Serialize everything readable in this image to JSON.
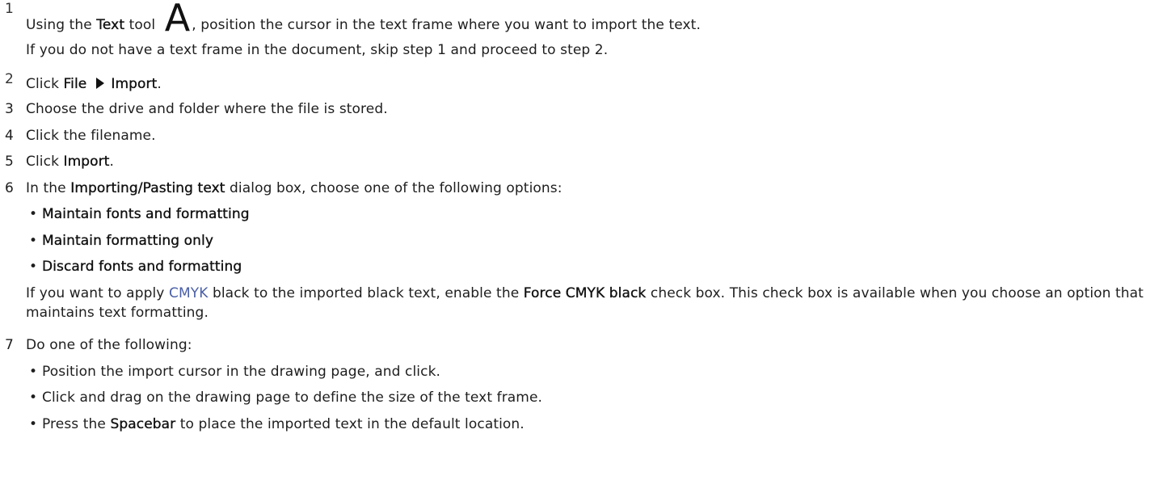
{
  "steps": [
    {
      "number": "1",
      "parts": {
        "a": "Using the ",
        "tool": "Text",
        "b": " tool ",
        "icon": "A",
        "c": ", position the cursor in the text frame where you want to import the text."
      },
      "note": "If you do not have a text frame in the document, skip step 1 and proceed to step 2."
    },
    {
      "number": "2",
      "parts": {
        "a": "Click ",
        "menu1": "File",
        "menu2": "Import",
        "end": "."
      }
    },
    {
      "number": "3",
      "text": "Choose the drive and folder where the file is stored."
    },
    {
      "number": "4",
      "text": "Click the filename."
    },
    {
      "number": "5",
      "parts": {
        "a": "Click ",
        "ui": "Import",
        "end": "."
      }
    },
    {
      "number": "6",
      "parts": {
        "a": "In the ",
        "ui": "Importing/Pasting text",
        "b": " dialog box, choose one of the following options:"
      },
      "options": [
        "Maintain fonts and formatting",
        "Maintain formatting only",
        "Discard fonts and formatting"
      ],
      "note": {
        "a": "If you want to apply ",
        "link": "CMYK",
        "b": " black to the imported black text, enable the ",
        "ui": "Force CMYK black",
        "c": " check box. This check box is available when you choose an option that maintains text formatting."
      }
    },
    {
      "number": "7",
      "text": "Do one of the following:",
      "bullets": [
        {
          "text": "Position the import cursor in the drawing page, and click."
        },
        {
          "text": "Click and drag on the drawing page to define the size of the text frame."
        },
        {
          "a": "Press the ",
          "ui": "Spacebar",
          "b": " to place the imported text in the default location."
        }
      ]
    }
  ],
  "bullet_glyph": "•",
  "icons": {
    "menu_arrow": "triangle-right-icon",
    "text_tool": "text-tool-icon"
  }
}
